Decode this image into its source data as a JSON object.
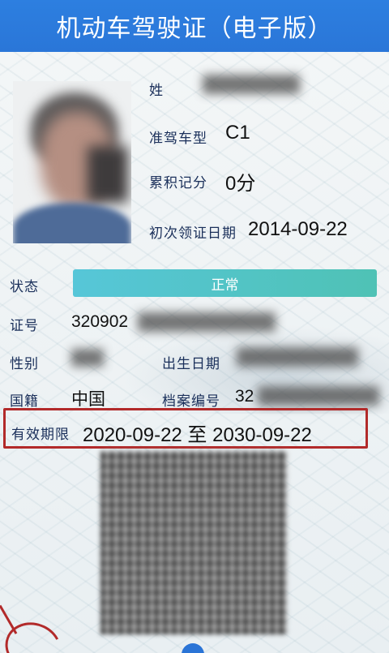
{
  "header": {
    "title": "机动车驾驶证（电子版）"
  },
  "labels": {
    "name": "姓",
    "class": "准驾车型",
    "points": "累积记分",
    "first_issue": "初次领证日期",
    "status": "状态",
    "cert_no": "证号",
    "sex": "性别",
    "birth": "出生日期",
    "nationality": "国籍",
    "file_no": "档案编号",
    "validity": "有效期限"
  },
  "values": {
    "class": "C1",
    "points": "0分",
    "first_issue": "2014-09-22",
    "status": "正常",
    "cert_no_prefix": "320902",
    "nationality": "中国",
    "file_no_prefix": "32",
    "validity": "2020-09-22 至 2030-09-22"
  },
  "colors": {
    "header": "#2a76d8",
    "status_bar": "#4fc2b5",
    "highlight": "#b22a2a",
    "label_text": "#1a2f5a"
  },
  "icons": [
    "photo",
    "qr-code"
  ]
}
